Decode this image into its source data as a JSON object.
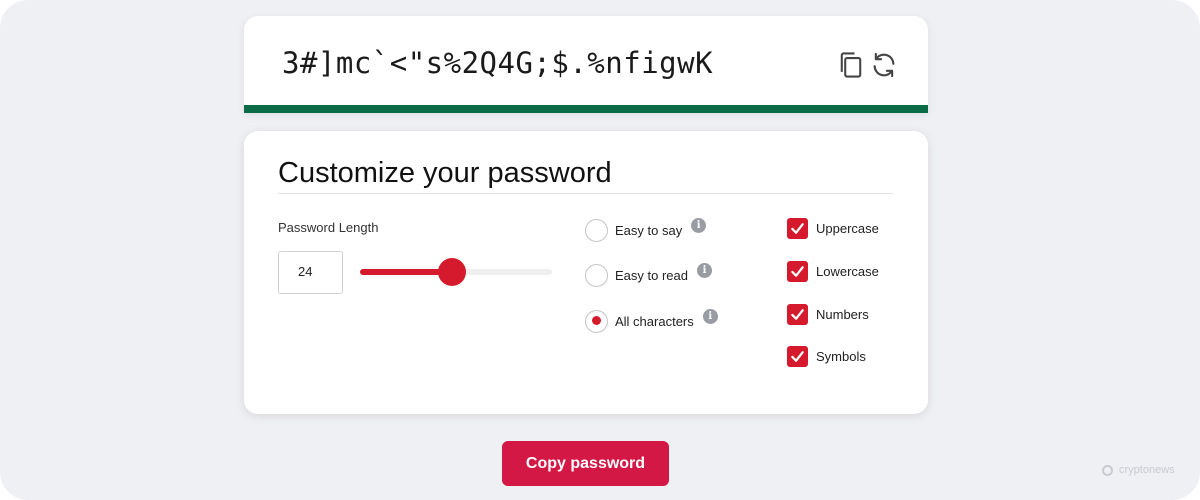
{
  "password": {
    "value": "3#]mc`<\"s%2Q4G;$.%nfigwK",
    "strength_color": "#0b6b47",
    "copy_icon": "copy-icon",
    "refresh_icon": "refresh-icon"
  },
  "customize": {
    "title": "Customize your password",
    "length_label": "Password Length",
    "length_value": "24",
    "length_slider_fraction": 0.48,
    "radio_options": [
      {
        "label": "Easy to say",
        "selected": false
      },
      {
        "label": "Easy to read",
        "selected": false
      },
      {
        "label": "All characters",
        "selected": true
      }
    ],
    "checkboxes": [
      {
        "label": "Uppercase",
        "checked": true
      },
      {
        "label": "Lowercase",
        "checked": true
      },
      {
        "label": "Numbers",
        "checked": true
      },
      {
        "label": "Symbols",
        "checked": true
      }
    ]
  },
  "copy_button": {
    "label": "Copy password"
  },
  "watermark": {
    "text": "cryptonews"
  },
  "colors": {
    "accent": "#d61a2d",
    "button": "#d41845",
    "background": "#eff0f4"
  }
}
